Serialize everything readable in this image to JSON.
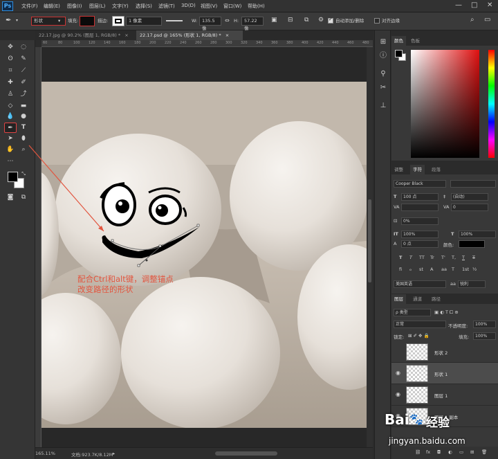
{
  "app": {
    "logo": "Ps"
  },
  "menu": [
    "文件(F)",
    "编辑(E)",
    "图像(I)",
    "图层(L)",
    "文字(Y)",
    "选择(S)",
    "滤镜(T)",
    "3D(D)",
    "视图(V)",
    "窗口(W)",
    "帮助(H)"
  ],
  "window_controls": {
    "minimize": "—",
    "maximize": "□",
    "close": "✕"
  },
  "options_bar": {
    "mode_value": "形状",
    "fill_label": "填充:",
    "stroke_label": "描边:",
    "stroke_size": "1 像素",
    "w_label": "W:",
    "w_value": "135.5 像",
    "h_label": "H:",
    "h_value": "57.22 像",
    "auto_add_delete": "自动添加/删除",
    "align_edges": "对齐边缘",
    "fill_color": "#0a0a0a"
  },
  "doc_tabs": [
    {
      "label": "22.17.jpg @ 90.2% (图层 1, RGB/8) *",
      "close": "×",
      "active": false
    },
    {
      "label": "22.17.psd @ 165% (形状 1, RGB/8) *",
      "close": "×",
      "active": true
    }
  ],
  "ruler": {
    "top_ticks": [
      "60",
      "80",
      "100",
      "120",
      "140",
      "160",
      "180",
      "200",
      "220",
      "240",
      "260",
      "280",
      "300",
      "320",
      "340",
      "360",
      "380",
      "400",
      "420",
      "440",
      "460",
      "480"
    ]
  },
  "canvas": {
    "annotation_line1": "配合Ctrl和alt键，调整锚点",
    "annotation_line2": "改变路径的形状",
    "annotation_color": "#e2553f"
  },
  "status": {
    "zoom": "165.11%",
    "doc": "文档:923.7K/8.12M"
  },
  "color_panel": {
    "tabs": [
      "颜色",
      "色板"
    ],
    "fg": "#000000",
    "bg": "#ffffff"
  },
  "char_panel": {
    "tabs": [
      "调整",
      "字符",
      "段落"
    ],
    "font": "Cooper Black",
    "size": "100 点",
    "leading": "(自动)",
    "tracking": "0",
    "scale_pct": "0%",
    "v_scale": "100%",
    "h_scale": "100%",
    "baseline": "0 点",
    "color_label": "颜色:",
    "language": "美国英语",
    "aa": "锐利",
    "text_style_buttons": [
      "T",
      "T",
      "TT",
      "Tr",
      "T'",
      "T,",
      "T",
      "T"
    ],
    "opentype_buttons": [
      "fi",
      "ℴ",
      "st",
      "A",
      "aa",
      "T",
      "1st",
      "½"
    ]
  },
  "layers_panel": {
    "tabs": [
      "图层",
      "通道",
      "路径"
    ],
    "filter": "ρ 类型",
    "blend": "正常",
    "opacity_label": "不透明度:",
    "opacity": "100%",
    "lock_label": "锁定:",
    "fill_label": "填充:",
    "fill": "100%",
    "layers": [
      {
        "name": "形状 2",
        "visible": false,
        "selected": false
      },
      {
        "name": "形状 1",
        "visible": true,
        "selected": true
      },
      {
        "name": "图层 1",
        "visible": true,
        "selected": false
      },
      {
        "name": "图层 1 副本",
        "visible": true,
        "selected": false
      }
    ],
    "footer_icons": [
      "link-icon",
      "fx",
      "mask-icon",
      "adjust-icon",
      "folder-icon",
      "new-icon",
      "trash-icon"
    ]
  },
  "watermark": {
    "brand": "Bai",
    "brand2": "经验",
    "url": "jingyan.baidu.com"
  }
}
